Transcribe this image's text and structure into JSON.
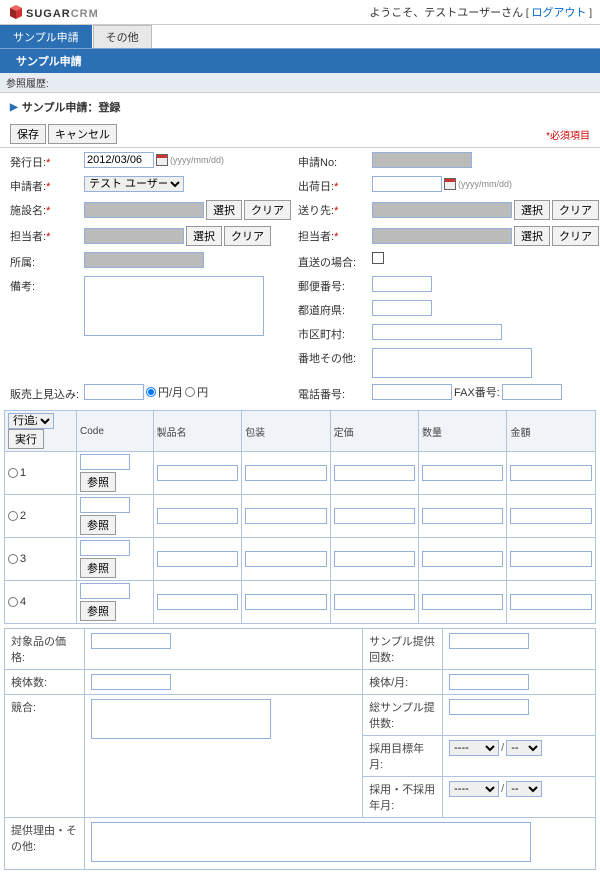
{
  "header": {
    "welcome": "ようこそ、テストユーザーさん",
    "logout": "ログアウト",
    "logo_bold": "SUGAR",
    "logo_light": "CRM"
  },
  "tabs": {
    "t1": "サンプル申請",
    "t2": "その他",
    "sub1": "サンプル申請",
    "hist": "参照履歴:"
  },
  "page": {
    "title": "サンプル申請：登録",
    "save": "保存",
    "cancel": "キャンセル",
    "req": "*必須項目"
  },
  "form": {
    "date_lbl": "発行日:",
    "date_val": "2012/03/06",
    "fmt": "(yyyy/mm/dd)",
    "reqno_lbl": "申請No:",
    "appl_lbl": "申請者:",
    "appl_val": "テスト ユーザー",
    "depart_lbl": "出荷日:",
    "fac_lbl": "施設名:",
    "select": "選択",
    "clear": "クリア",
    "dest_lbl": "送り先:",
    "pic_lbl": "担当者:",
    "pic2_lbl": "担当者:",
    "dept_lbl": "所属:",
    "direct_lbl": "直送の場合:",
    "note_lbl": "備考:",
    "zip_lbl": "郵便番号:",
    "pref_lbl": "都道府県:",
    "city_lbl": "市区町村:",
    "addr_lbl": "番地その他:",
    "sales_lbl": "販売上見込み:",
    "unit1": "円/月",
    "unit2": "円",
    "tel_lbl": "電話番号:",
    "fax_lbl": "FAX番号:"
  },
  "grid": {
    "addrow": "行追加",
    "exec": "実行",
    "code": "Code",
    "name": "製品名",
    "pkg": "包装",
    "price": "定価",
    "qty": "数量",
    "amt": "金額",
    "ref": "参照",
    "r1": "1",
    "r2": "2",
    "r3": "3",
    "r4": "4"
  },
  "lower": {
    "price_lbl": "対象品の価格:",
    "supply_lbl": "サンプル提供回数:",
    "test_lbl": "検体数:",
    "testmo_lbl": "検体/月:",
    "comp_lbl": "競合:",
    "total_lbl": "総サンプル提供数:",
    "tgt_lbl": "採用目標年月:",
    "adopt_lbl": "採用・不採用年月:",
    "dash": "----",
    "reason_lbl": "提供理由・その他:"
  }
}
